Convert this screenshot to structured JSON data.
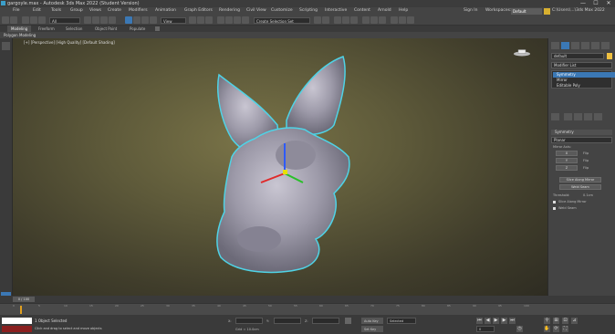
{
  "window": {
    "title": "gargoyle.max - Autodesk 3ds Max 2022 (Student Version)",
    "minimize": "—",
    "maximize": "☐",
    "close": "✕"
  },
  "menubar": {
    "items": [
      "File",
      "Edit",
      "Tools",
      "Group",
      "Views",
      "Create",
      "Modifiers",
      "Animation",
      "Graph Editors",
      "Rendering",
      "Civil View",
      "Customize",
      "Scripting",
      "Interactive",
      "Content",
      "Arnold",
      "Help"
    ],
    "sign_in": "Sign In",
    "workspace_label": "Workspaces:",
    "workspace_value": "Default",
    "project_path": "C:\\Users\\...\\3ds Max 2022"
  },
  "toolbar": {
    "selection_filter": "All",
    "view_dropdown": "View",
    "named_selection": "Create Selection Set"
  },
  "ribbon": {
    "tabs": [
      "Modeling",
      "Freeform",
      "Selection",
      "Object Paint",
      "Populate"
    ],
    "active_tab": "Modeling",
    "sub_label": "Polygon Modeling"
  },
  "viewport": {
    "label": "[+] [Perspective] [High Quality] [Default Shading]"
  },
  "command_panel": {
    "object_name": "default",
    "modifier_list": "Modifier List",
    "stack": [
      {
        "label": "Symmetry",
        "selected": true
      },
      {
        "label": "Mirror",
        "selected": false
      },
      {
        "label": "Editable Poly",
        "selected": false
      }
    ],
    "rollout_title": "Symmetry",
    "mode_dropdown": "Planar",
    "mirror_axis_label": "Mirror Axis:",
    "axes": [
      "X",
      "Y",
      "Z"
    ],
    "flip_label": "Flip",
    "slice_along_mirror": "Slice Along Mirror",
    "weld_seam": "Weld Seam",
    "threshold_label": "Threshold:",
    "threshold_value": "0.1cm",
    "slice_label": "Slice Along Mirror",
    "weld_label": "Weld Seam"
  },
  "timeline": {
    "frame": "0 / 100",
    "ticks": [
      "0",
      "5",
      "10",
      "15",
      "20",
      "25",
      "30",
      "35",
      "40",
      "45",
      "50",
      "55",
      "60",
      "65",
      "70",
      "75",
      "80",
      "85",
      "90",
      "95",
      "100"
    ]
  },
  "statusbar": {
    "selection_status": "1 Object Selected",
    "prompt": "Click and drag to select and move objects",
    "x_label": "X:",
    "y_label": "Y:",
    "z_label": "Z:",
    "grid": "Grid = 10.0cm",
    "auto_key": "Auto Key",
    "set_key": "Set Key",
    "key_filter": "Selected",
    "frame_value": "0"
  }
}
